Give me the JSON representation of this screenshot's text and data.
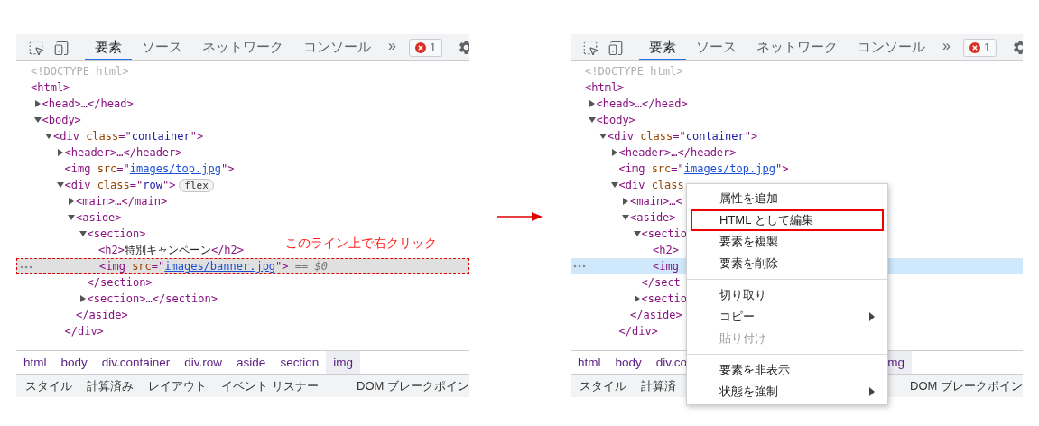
{
  "panels": [
    {
      "focused": false,
      "annotation": "このライン上で右クリック",
      "toolbar": {
        "tabs": [
          {
            "label": "要素",
            "selected": true
          },
          {
            "label": "ソース",
            "selected": false
          },
          {
            "label": "ネットワーク",
            "selected": false
          },
          {
            "label": "コンソール",
            "selected": false
          }
        ],
        "more": "»",
        "error_count": "1"
      },
      "tree": [
        {
          "selected": false,
          "tokens": [
            {
              "kind": "doctype",
              "text": "<!DOCTYPE html>"
            }
          ]
        },
        {
          "selected": false,
          "tokens": [
            {
              "kind": "tag",
              "text": "<html>"
            }
          ],
          "children": [
            {
              "selected": false,
              "expanded": false,
              "tokens": [
                {
                  "kind": "tag",
                  "text": "<head>…</head>"
                }
              ]
            },
            {
              "selected": false,
              "expanded": true,
              "tokens": [
                {
                  "kind": "tag",
                  "text": "<body>"
                }
              ],
              "children": [
                {
                  "selected": false,
                  "expanded": true,
                  "tokens": [
                    {
                      "kind": "tag",
                      "text": "<div"
                    },
                    {
                      "kind": "attr",
                      "text": " class"
                    },
                    {
                      "kind": "tag",
                      "text": "=\""
                    },
                    {
                      "kind": "value",
                      "text": "container"
                    },
                    {
                      "kind": "tag",
                      "text": "\">"
                    }
                  ],
                  "children": [
                    {
                      "selected": false,
                      "expanded": false,
                      "tokens": [
                        {
                          "kind": "tag",
                          "text": "<header>…</header>"
                        }
                      ]
                    },
                    {
                      "selected": false,
                      "tokens": [
                        {
                          "kind": "tag",
                          "text": "<img"
                        },
                        {
                          "kind": "attr",
                          "text": " src"
                        },
                        {
                          "kind": "tag",
                          "text": "=\""
                        },
                        {
                          "kind": "link",
                          "text": "images/top.jpg"
                        },
                        {
                          "kind": "tag",
                          "text": "\">"
                        }
                      ]
                    },
                    {
                      "selected": false,
                      "expanded": true,
                      "tokens": [
                        {
                          "kind": "tag",
                          "text": "<div"
                        },
                        {
                          "kind": "attr",
                          "text": " class"
                        },
                        {
                          "kind": "tag",
                          "text": "=\""
                        },
                        {
                          "kind": "value",
                          "text": "row"
                        },
                        {
                          "kind": "tag",
                          "text": "\">"
                        },
                        {
                          "kind": "badge",
                          "text": "flex"
                        }
                      ],
                      "children": [
                        {
                          "selected": false,
                          "expanded": false,
                          "tokens": [
                            {
                              "kind": "tag",
                              "text": "<main>…</main>"
                            }
                          ]
                        },
                        {
                          "selected": false,
                          "expanded": true,
                          "tokens": [
                            {
                              "kind": "tag",
                              "text": "<aside>"
                            }
                          ],
                          "children": [
                            {
                              "selected": false,
                              "expanded": true,
                              "tokens": [
                                {
                                  "kind": "tag",
                                  "text": "<section>"
                                }
                              ],
                              "children": [
                                {
                                  "selected": false,
                                  "tokens": [
                                    {
                                      "kind": "tag",
                                      "text": "<h2>"
                                    },
                                    {
                                      "kind": "text",
                                      "text": "特別キャンペーン"
                                    },
                                    {
                                      "kind": "tag",
                                      "text": "</h2>"
                                    }
                                  ]
                                },
                                {
                                  "selected": true,
                                  "tokens": [
                                    {
                                      "kind": "tag",
                                      "text": "<img"
                                    },
                                    {
                                      "kind": "attr",
                                      "text": " src"
                                    },
                                    {
                                      "kind": "tag",
                                      "text": "=\""
                                    },
                                    {
                                      "kind": "link",
                                      "text": "images/banner.jpg"
                                    },
                                    {
                                      "kind": "tag",
                                      "text": "\">"
                                    },
                                    {
                                      "kind": "note",
                                      "text": " == $0"
                                    }
                                  ]
                                }
                              ],
                              "close": [
                                {
                                  "kind": "tag",
                                  "text": "</section>"
                                }
                              ]
                            },
                            {
                              "selected": false,
                              "expanded": false,
                              "tokens": [
                                {
                                  "kind": "tag",
                                  "text": "<section>…</section>"
                                }
                              ]
                            }
                          ],
                          "close": [
                            {
                              "kind": "tag",
                              "text": "</aside>"
                            }
                          ]
                        }
                      ],
                      "close": [
                        {
                          "kind": "tag",
                          "text": "</div>"
                        }
                      ]
                    }
                  ]
                }
              ]
            }
          ]
        }
      ],
      "breadcrumbs": [
        {
          "label": "html",
          "selected": false
        },
        {
          "label": "body",
          "selected": false
        },
        {
          "label": "div.container",
          "selected": false
        },
        {
          "label": "div.row",
          "selected": false
        },
        {
          "label": "aside",
          "selected": false
        },
        {
          "label": "section",
          "selected": false
        },
        {
          "label": "img",
          "selected": true
        }
      ],
      "bottom_tabs": [
        "スタイル",
        "計算済み",
        "レイアウト",
        "イベント リスナー",
        "DOM ブレークポイン"
      ]
    },
    {
      "focused": true,
      "toolbar": {
        "tabs": [
          {
            "label": "要素",
            "selected": true
          },
          {
            "label": "ソース",
            "selected": false
          },
          {
            "label": "ネットワーク",
            "selected": false
          },
          {
            "label": "コンソール",
            "selected": false
          }
        ],
        "more": "»",
        "error_count": "1"
      },
      "tree": [
        {
          "selected": false,
          "tokens": [
            {
              "kind": "doctype",
              "text": "<!DOCTYPE html>"
            }
          ]
        },
        {
          "selected": false,
          "tokens": [
            {
              "kind": "tag",
              "text": "<html>"
            }
          ],
          "children": [
            {
              "selected": false,
              "expanded": false,
              "tokens": [
                {
                  "kind": "tag",
                  "text": "<head>…</head>"
                }
              ]
            },
            {
              "selected": false,
              "expanded": true,
              "tokens": [
                {
                  "kind": "tag",
                  "text": "<body>"
                }
              ],
              "children": [
                {
                  "selected": false,
                  "expanded": true,
                  "tokens": [
                    {
                      "kind": "tag",
                      "text": "<div"
                    },
                    {
                      "kind": "attr",
                      "text": " class"
                    },
                    {
                      "kind": "tag",
                      "text": "=\""
                    },
                    {
                      "kind": "value",
                      "text": "container"
                    },
                    {
                      "kind": "tag",
                      "text": "\">"
                    }
                  ],
                  "children": [
                    {
                      "selected": false,
                      "expanded": false,
                      "tokens": [
                        {
                          "kind": "tag",
                          "text": "<header>…</header>"
                        }
                      ]
                    },
                    {
                      "selected": false,
                      "tokens": [
                        {
                          "kind": "tag",
                          "text": "<img"
                        },
                        {
                          "kind": "attr",
                          "text": " src"
                        },
                        {
                          "kind": "tag",
                          "text": "=\""
                        },
                        {
                          "kind": "link",
                          "text": "images/top.jpg"
                        },
                        {
                          "kind": "tag",
                          "text": "\">"
                        }
                      ]
                    },
                    {
                      "selected": false,
                      "expanded": true,
                      "tokens": [
                        {
                          "kind": "tag",
                          "text": "<div"
                        },
                        {
                          "kind": "attr",
                          "text": " class"
                        }
                      ],
                      "children": [
                        {
                          "selected": false,
                          "expanded": false,
                          "tokens": [
                            {
                              "kind": "tag",
                              "text": "<main>…<"
                            }
                          ]
                        },
                        {
                          "selected": false,
                          "expanded": true,
                          "tokens": [
                            {
                              "kind": "tag",
                              "text": "<aside>"
                            }
                          ],
                          "children": [
                            {
                              "selected": false,
                              "expanded": true,
                              "tokens": [
                                {
                                  "kind": "tag",
                                  "text": "<sectio"
                                }
                              ],
                              "children": [
                                {
                                  "selected": false,
                                  "tokens": [
                                    {
                                      "kind": "tag",
                                      "text": "<h2>"
                                    }
                                  ]
                                },
                                {
                                  "selected": true,
                                  "tokens": [
                                    {
                                      "kind": "tag",
                                      "text": "<img"
                                    }
                                  ]
                                }
                              ],
                              "close": [
                                {
                                  "kind": "tag",
                                  "text": "</sect"
                                }
                              ]
                            },
                            {
                              "selected": false,
                              "expanded": false,
                              "tokens": [
                                {
                                  "kind": "tag",
                                  "text": "<sectio"
                                }
                              ]
                            }
                          ],
                          "close": [
                            {
                              "kind": "tag",
                              "text": "</aside>"
                            }
                          ]
                        }
                      ],
                      "close": [
                        {
                          "kind": "tag",
                          "text": "</div>"
                        }
                      ]
                    }
                  ]
                }
              ]
            }
          ]
        }
      ],
      "breadcrumbs": [
        {
          "label": "html",
          "selected": false
        },
        {
          "label": "body",
          "selected": false
        },
        {
          "label": "div.co",
          "selected": false
        },
        {
          "label": "mg",
          "selected": true
        }
      ],
      "bottom_tabs": [
        "スタイル",
        "計算済",
        "DOM ブレークポイン"
      ],
      "context_menu": {
        "items": [
          {
            "kind": "item",
            "label": "属性を追加",
            "disabled": false,
            "submenu": false,
            "annotated": false
          },
          {
            "kind": "item",
            "label": "HTML として編集",
            "disabled": false,
            "submenu": false,
            "annotated": true
          },
          {
            "kind": "item",
            "label": "要素を複製",
            "disabled": false,
            "submenu": false,
            "annotated": false
          },
          {
            "kind": "item",
            "label": "要素を削除",
            "disabled": false,
            "submenu": false,
            "annotated": false
          },
          {
            "kind": "separator"
          },
          {
            "kind": "item",
            "label": "切り取り",
            "disabled": false,
            "submenu": false,
            "annotated": false
          },
          {
            "kind": "item",
            "label": "コピー",
            "disabled": false,
            "submenu": true,
            "annotated": false
          },
          {
            "kind": "item",
            "label": "貼り付け",
            "disabled": true,
            "submenu": false,
            "annotated": false
          },
          {
            "kind": "separator"
          },
          {
            "kind": "item",
            "label": "要素を非表示",
            "disabled": false,
            "submenu": false,
            "annotated": false
          },
          {
            "kind": "item",
            "label": "状態を強制",
            "disabled": false,
            "submenu": true,
            "annotated": false
          }
        ]
      }
    }
  ]
}
